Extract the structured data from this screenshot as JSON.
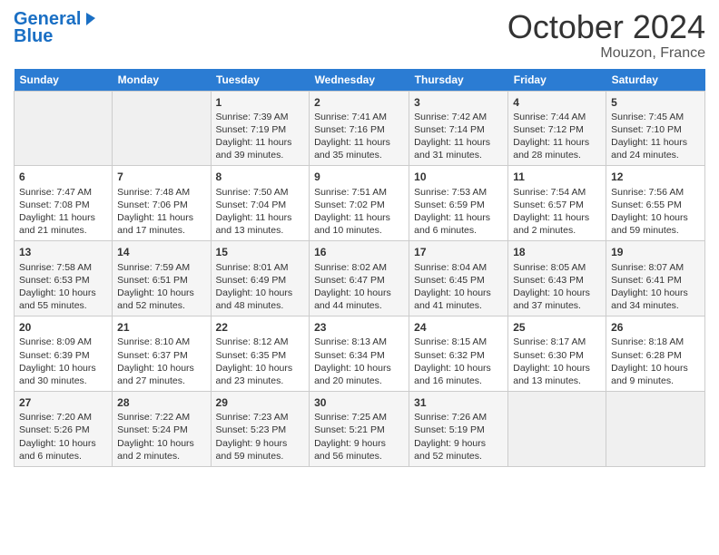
{
  "header": {
    "logo_line1": "General",
    "logo_line2": "Blue",
    "month": "October 2024",
    "location": "Mouzon, France"
  },
  "weekdays": [
    "Sunday",
    "Monday",
    "Tuesday",
    "Wednesday",
    "Thursday",
    "Friday",
    "Saturday"
  ],
  "weeks": [
    [
      {
        "day": "",
        "info": ""
      },
      {
        "day": "",
        "info": ""
      },
      {
        "day": "1",
        "info": "Sunrise: 7:39 AM\nSunset: 7:19 PM\nDaylight: 11 hours and 39 minutes."
      },
      {
        "day": "2",
        "info": "Sunrise: 7:41 AM\nSunset: 7:16 PM\nDaylight: 11 hours and 35 minutes."
      },
      {
        "day": "3",
        "info": "Sunrise: 7:42 AM\nSunset: 7:14 PM\nDaylight: 11 hours and 31 minutes."
      },
      {
        "day": "4",
        "info": "Sunrise: 7:44 AM\nSunset: 7:12 PM\nDaylight: 11 hours and 28 minutes."
      },
      {
        "day": "5",
        "info": "Sunrise: 7:45 AM\nSunset: 7:10 PM\nDaylight: 11 hours and 24 minutes."
      }
    ],
    [
      {
        "day": "6",
        "info": "Sunrise: 7:47 AM\nSunset: 7:08 PM\nDaylight: 11 hours and 21 minutes."
      },
      {
        "day": "7",
        "info": "Sunrise: 7:48 AM\nSunset: 7:06 PM\nDaylight: 11 hours and 17 minutes."
      },
      {
        "day": "8",
        "info": "Sunrise: 7:50 AM\nSunset: 7:04 PM\nDaylight: 11 hours and 13 minutes."
      },
      {
        "day": "9",
        "info": "Sunrise: 7:51 AM\nSunset: 7:02 PM\nDaylight: 11 hours and 10 minutes."
      },
      {
        "day": "10",
        "info": "Sunrise: 7:53 AM\nSunset: 6:59 PM\nDaylight: 11 hours and 6 minutes."
      },
      {
        "day": "11",
        "info": "Sunrise: 7:54 AM\nSunset: 6:57 PM\nDaylight: 11 hours and 2 minutes."
      },
      {
        "day": "12",
        "info": "Sunrise: 7:56 AM\nSunset: 6:55 PM\nDaylight: 10 hours and 59 minutes."
      }
    ],
    [
      {
        "day": "13",
        "info": "Sunrise: 7:58 AM\nSunset: 6:53 PM\nDaylight: 10 hours and 55 minutes."
      },
      {
        "day": "14",
        "info": "Sunrise: 7:59 AM\nSunset: 6:51 PM\nDaylight: 10 hours and 52 minutes."
      },
      {
        "day": "15",
        "info": "Sunrise: 8:01 AM\nSunset: 6:49 PM\nDaylight: 10 hours and 48 minutes."
      },
      {
        "day": "16",
        "info": "Sunrise: 8:02 AM\nSunset: 6:47 PM\nDaylight: 10 hours and 44 minutes."
      },
      {
        "day": "17",
        "info": "Sunrise: 8:04 AM\nSunset: 6:45 PM\nDaylight: 10 hours and 41 minutes."
      },
      {
        "day": "18",
        "info": "Sunrise: 8:05 AM\nSunset: 6:43 PM\nDaylight: 10 hours and 37 minutes."
      },
      {
        "day": "19",
        "info": "Sunrise: 8:07 AM\nSunset: 6:41 PM\nDaylight: 10 hours and 34 minutes."
      }
    ],
    [
      {
        "day": "20",
        "info": "Sunrise: 8:09 AM\nSunset: 6:39 PM\nDaylight: 10 hours and 30 minutes."
      },
      {
        "day": "21",
        "info": "Sunrise: 8:10 AM\nSunset: 6:37 PM\nDaylight: 10 hours and 27 minutes."
      },
      {
        "day": "22",
        "info": "Sunrise: 8:12 AM\nSunset: 6:35 PM\nDaylight: 10 hours and 23 minutes."
      },
      {
        "day": "23",
        "info": "Sunrise: 8:13 AM\nSunset: 6:34 PM\nDaylight: 10 hours and 20 minutes."
      },
      {
        "day": "24",
        "info": "Sunrise: 8:15 AM\nSunset: 6:32 PM\nDaylight: 10 hours and 16 minutes."
      },
      {
        "day": "25",
        "info": "Sunrise: 8:17 AM\nSunset: 6:30 PM\nDaylight: 10 hours and 13 minutes."
      },
      {
        "day": "26",
        "info": "Sunrise: 8:18 AM\nSunset: 6:28 PM\nDaylight: 10 hours and 9 minutes."
      }
    ],
    [
      {
        "day": "27",
        "info": "Sunrise: 7:20 AM\nSunset: 5:26 PM\nDaylight: 10 hours and 6 minutes."
      },
      {
        "day": "28",
        "info": "Sunrise: 7:22 AM\nSunset: 5:24 PM\nDaylight: 10 hours and 2 minutes."
      },
      {
        "day": "29",
        "info": "Sunrise: 7:23 AM\nSunset: 5:23 PM\nDaylight: 9 hours and 59 minutes."
      },
      {
        "day": "30",
        "info": "Sunrise: 7:25 AM\nSunset: 5:21 PM\nDaylight: 9 hours and 56 minutes."
      },
      {
        "day": "31",
        "info": "Sunrise: 7:26 AM\nSunset: 5:19 PM\nDaylight: 9 hours and 52 minutes."
      },
      {
        "day": "",
        "info": ""
      },
      {
        "day": "",
        "info": ""
      }
    ]
  ]
}
